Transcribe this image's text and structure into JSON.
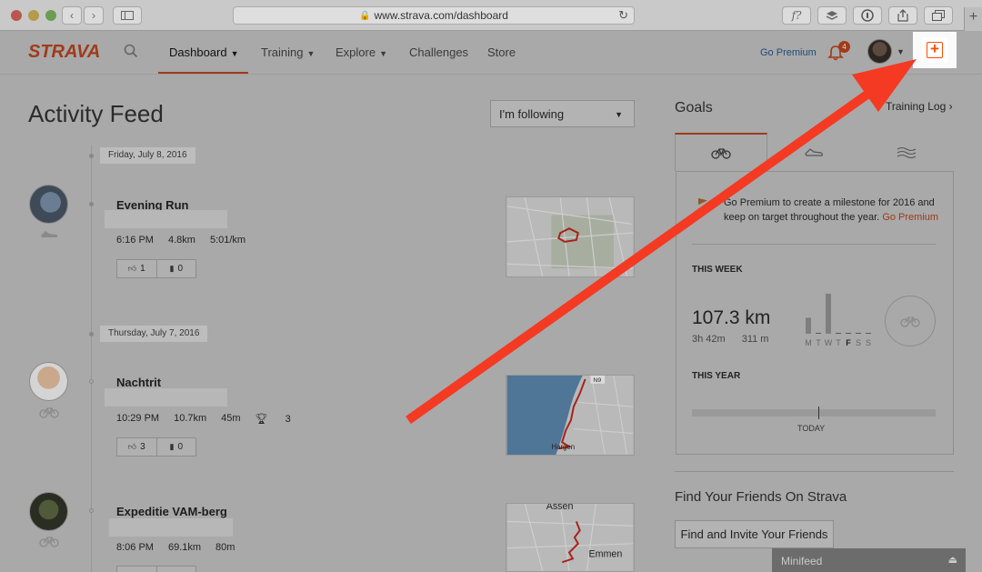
{
  "browser": {
    "url": "www.strava.com/dashboard",
    "toolbar_icons": [
      "back-icon",
      "forward-icon",
      "sidebar-icon",
      "reload-icon",
      "formula-icon",
      "layers-icon",
      "info-icon",
      "share-icon",
      "tabs-icon",
      "new-tab-icon"
    ],
    "formula_label": "f?"
  },
  "header": {
    "logo": "STRAVA",
    "nav": [
      {
        "label": "Dashboard",
        "caret": true,
        "active": true
      },
      {
        "label": "Training",
        "caret": true
      },
      {
        "label": "Explore",
        "caret": true
      },
      {
        "label": "Challenges",
        "caret": false
      },
      {
        "label": "Store",
        "caret": false
      }
    ],
    "go_premium": "Go Premium",
    "notification_count": "4",
    "accent": "#fc4c02"
  },
  "feed": {
    "title": "Activity Feed",
    "filter": "I'm following",
    "groups": [
      {
        "date": "Friday, July 8, 2016",
        "activity": {
          "name": "Evening Run",
          "sport": "run-shoe-icon",
          "stats": [
            "6:16 PM",
            "4.8km",
            "5:01/km"
          ],
          "kudos": "1",
          "comments": "0"
        }
      },
      {
        "date": "Thursday, July 7, 2016",
        "activity": {
          "name": "Nachtrit",
          "sport": "bike-icon",
          "stats": [
            "10:29 PM",
            "10.7km",
            "45m"
          ],
          "achievements": "3",
          "kudos": "3",
          "comments": "0"
        }
      },
      {
        "activity": {
          "name": "Expeditie VAM-berg",
          "sport": "bike-icon",
          "stats": [
            "8:06 PM",
            "69.1km",
            "80m"
          ]
        }
      }
    ],
    "map_labels": {
      "n9": "N9",
      "hargen": "Hargen",
      "assen": "Assen",
      "emmen": "Emmen"
    }
  },
  "goals": {
    "title": "Goals",
    "training_log": "Training Log",
    "promo_text": "Go Premium to create a milestone for 2016 and keep on target throughout the year.",
    "promo_link": "Go Premium",
    "this_week": "THIS WEEK",
    "week_distance": "107.3 km",
    "week_time": "3h 42m",
    "week_elev": "311 m",
    "week_days": [
      "M",
      "T",
      "W",
      "T",
      "F",
      "S",
      "S"
    ],
    "week_bars": [
      0.4,
      0,
      1.0,
      0,
      0,
      0,
      0
    ],
    "this_year": "THIS YEAR",
    "today": "TODAY"
  },
  "friends": {
    "title": "Find Your Friends On Strava",
    "button": "Find and Invite Your Friends"
  },
  "minifeed": {
    "label": "Minifeed"
  }
}
